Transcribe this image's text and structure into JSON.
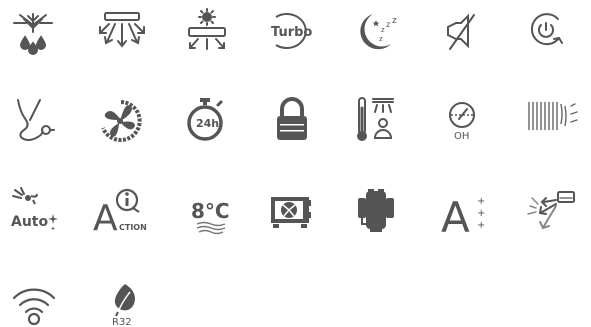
{
  "icons": [
    {
      "name": "freeze-protection-icon"
    },
    {
      "name": "airflow-3d-icon"
    },
    {
      "name": "heating-mode-icon"
    },
    {
      "name": "turbo-icon",
      "label": "Turbo"
    },
    {
      "name": "sleep-mode-icon",
      "label": "z z z"
    },
    {
      "name": "mute-icon"
    },
    {
      "name": "timer-power-icon"
    },
    {
      "name": "ionizer-icon"
    },
    {
      "name": "fan-speed-icon"
    },
    {
      "name": "timer-24h-icon",
      "label": "24h"
    },
    {
      "name": "child-lock-icon"
    },
    {
      "name": "i-feel-icon"
    },
    {
      "name": "oh-icon",
      "label": "OH"
    },
    {
      "name": "filter-icon"
    },
    {
      "name": "auto-clean-icon",
      "label": "Auto"
    },
    {
      "name": "action-icon",
      "label_a": "A",
      "label_action": "CTION"
    },
    {
      "name": "eight-degree-icon",
      "label": "8°C"
    },
    {
      "name": "outdoor-unit-icon"
    },
    {
      "name": "compressor-icon"
    },
    {
      "name": "energy-class-icon",
      "label": "A",
      "plus": "+"
    },
    {
      "name": "air-swing-icon"
    },
    {
      "name": "wifi-icon"
    },
    {
      "name": "refrigerant-r32-icon",
      "label": "R32"
    }
  ],
  "colors": {
    "icon": "#555555",
    "icon_light": "#888888",
    "background": "#ffffff"
  }
}
